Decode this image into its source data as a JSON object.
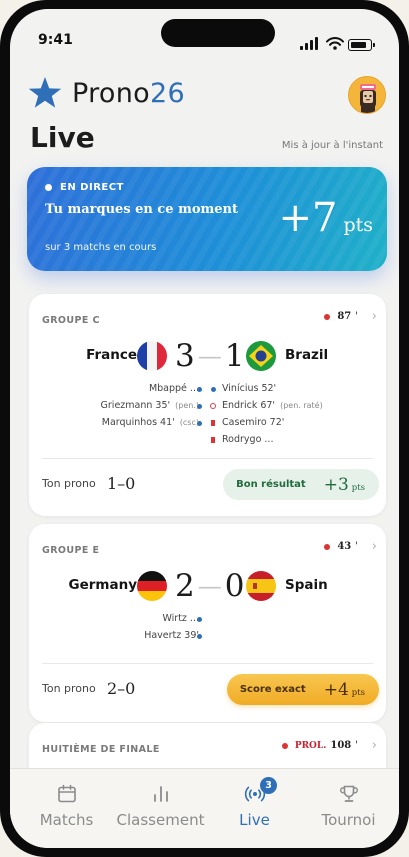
{
  "status_bar": {
    "time": "9:41"
  },
  "brand": {
    "name": "Prono",
    "number": "26"
  },
  "header": {
    "title": "Live",
    "updated": "Mis à jour à l'instant"
  },
  "live_banner": {
    "tag": "EN DIRECT",
    "headline": "Tu marques en ce moment",
    "points": "+7",
    "points_unit": "pts",
    "subtitle": "sur 3 matchs en cours"
  },
  "matches": [
    {
      "group": "GROUPE C",
      "minute": "87",
      "home": {
        "name": "France",
        "flag": "france-flag-icon"
      },
      "away": {
        "name": "Brazil",
        "flag": "brazil-flag-icon"
      },
      "home_score": "3",
      "away_score": "1",
      "home_events": [
        {
          "text": "Mbappé ...",
          "note": ""
        },
        {
          "text": "Griezmann 35'",
          "note": "(pen.)"
        },
        {
          "text": "Marquinhos 41'",
          "note": "(csc)"
        }
      ],
      "away_events": [
        {
          "text": "Vinícius 52'",
          "note": ""
        },
        {
          "text": "Endrick 67'",
          "note": "(pen. raté)"
        },
        {
          "text": "Casemiro 72'",
          "note": ""
        },
        {
          "text": "Rodrygo ...",
          "note": ""
        }
      ],
      "prono_label": "Ton prono",
      "prono": "1–0",
      "result": "Bon résultat",
      "result_points": "+3",
      "result_unit": "pts"
    },
    {
      "group": "GROUPE E",
      "minute": "43",
      "home": {
        "name": "Germany",
        "flag": "germany-flag-icon"
      },
      "away": {
        "name": "Spain",
        "flag": "spain-flag-icon"
      },
      "home_score": "2",
      "away_score": "0",
      "home_events": [
        {
          "text": "Wirtz ...",
          "note": ""
        },
        {
          "text": "Havertz 39'",
          "note": ""
        }
      ],
      "away_events": [],
      "prono_label": "Ton prono",
      "prono": "2–0",
      "result": "Score exact",
      "result_points": "+4",
      "result_unit": "pts"
    },
    {
      "group": "HUITIÈME DE FINALE",
      "minute_prefix": "PROL.",
      "minute": "108"
    }
  ],
  "tabs": [
    {
      "label": "Matchs",
      "icon": "calendar-icon",
      "active": false
    },
    {
      "label": "Classement",
      "icon": "bar-chart-icon",
      "active": false
    },
    {
      "label": "Live",
      "icon": "broadcast-icon",
      "active": true,
      "badge": "3"
    },
    {
      "label": "Tournoi",
      "icon": "trophy-icon",
      "active": false
    }
  ],
  "colors": {
    "accent": "#2f6fb8",
    "banner_start": "#2e6fd9",
    "banner_end": "#1fb1c8",
    "live_dot": "#dd3333",
    "good_result": "#226b3e",
    "exact_result": "#f0ab25"
  }
}
